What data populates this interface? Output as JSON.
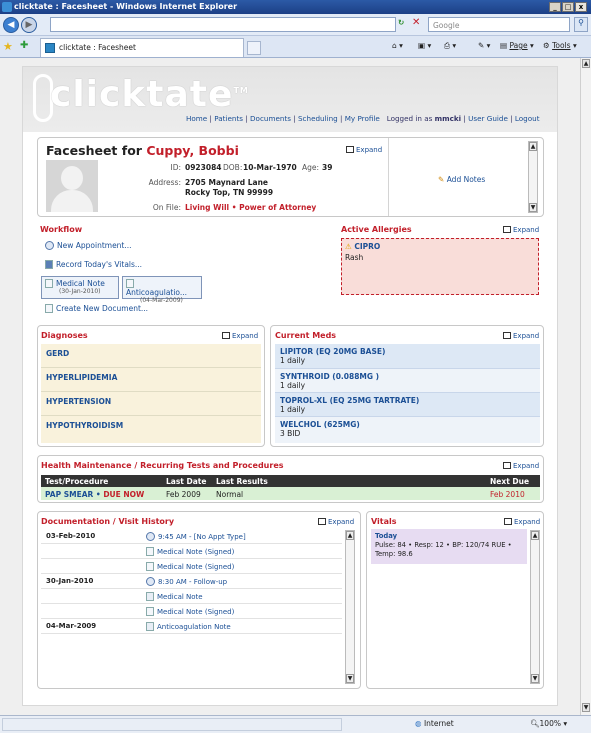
{
  "browser": {
    "title": "clicktate : Facesheet - Windows Internet Explorer",
    "tab_label": "clicktate : Facesheet",
    "search_placeholder": "Google",
    "page_label": "Page",
    "tools_label": "Tools",
    "status_zone": "Internet",
    "zoom": "100%"
  },
  "app": {
    "logo": "clicktate",
    "logo_tm": "TM",
    "nav": [
      "Home",
      "Patients",
      "Documents",
      "Scheduling",
      "My Profile"
    ],
    "logged_prefix": "Logged in as",
    "user": "mmcki",
    "user_guide": "User Guide",
    "logout": "Logout"
  },
  "patient": {
    "heading_prefix": "Facesheet for",
    "name": "Cuppy, Bobbi",
    "id_label": "ID:",
    "id": "0923084",
    "dob_label": "DOB:",
    "dob": "10-Mar-1970",
    "age_label": "Age:",
    "age": "39",
    "address_label": "Address:",
    "address1": "2705 Maynard Lane",
    "address2": "Rocky Top, TN 99999",
    "onfile_label": "On File:",
    "onfile1": "Living Will",
    "onfile2": "Power of Attorney",
    "expand": "Expand",
    "add_notes": "Add Notes"
  },
  "workflow": {
    "title": "Workflow",
    "new_appt": "New Appointment...",
    "record_vitals": "Record Today's Vitals...",
    "doc1_title": "Medical Note",
    "doc1_date": "(30-Jan-2010)",
    "doc2_title": "Anticoagulatio...",
    "doc2_date": "(04-Mar-2009)",
    "create_doc": "Create New Document..."
  },
  "allergies": {
    "title": "Active Allergies",
    "expand": "Expand",
    "name": "CIPRO",
    "reaction": "Rash"
  },
  "diagnoses": {
    "title": "Diagnoses",
    "expand": "Expand",
    "items": [
      "GERD",
      "HYPERLIPIDEMIA",
      "HYPERTENSION",
      "HYPOTHYROIDISM"
    ]
  },
  "meds": {
    "title": "Current Meds",
    "expand": "Expand",
    "items": [
      {
        "name": "LIPITOR (EQ 20MG BASE)",
        "sig": "1 daily"
      },
      {
        "name": "SYNTHROID (0.088MG )",
        "sig": "1 daily"
      },
      {
        "name": "TOPROL-XL (EQ 25MG TARTRATE)",
        "sig": "1 daily"
      },
      {
        "name": "WELCHOL (625MG)",
        "sig": "3 BID"
      }
    ]
  },
  "health": {
    "title": "Health Maintenance / Recurring Tests and Procedures",
    "expand": "Expand",
    "cols": [
      "Test/Procedure",
      "Last Date",
      "Last Results",
      "Next Due"
    ],
    "row": {
      "test": "PAP SMEAR",
      "flag": "DUE NOW",
      "last_date": "Feb 2009",
      "result": "Normal",
      "next_due": "Feb 2010"
    }
  },
  "history": {
    "title": "Documentation / Visit History",
    "expand": "Expand",
    "rows": [
      {
        "date": "03-Feb-2010",
        "text": "9:45 AM - [No Appt Type]"
      },
      {
        "date": "",
        "text": "Medical Note (Signed)"
      },
      {
        "date": "",
        "text": "Medical Note (Signed)"
      },
      {
        "date": "30-Jan-2010",
        "text": "8:30 AM - Follow-up"
      },
      {
        "date": "",
        "text": "Medical Note"
      },
      {
        "date": "",
        "text": "Medical Note (Signed)"
      },
      {
        "date": "04-Mar-2009",
        "text": "Anticoagulation Note"
      }
    ]
  },
  "vitals": {
    "title": "Vitals",
    "expand": "Expand",
    "today": "Today",
    "line1": "Pulse: 84 • Resp: 12 • BP: 120/74 RUE •",
    "line2": "Temp: 98.6"
  }
}
